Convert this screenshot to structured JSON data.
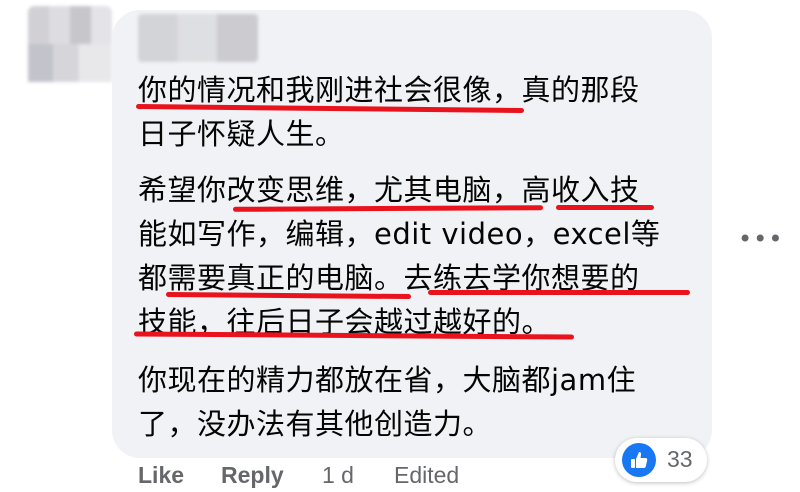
{
  "comment": {
    "paragraphs": [
      "你的情况和我刚进社会很像，真的那段\n日子怀疑人生。",
      "希望你改变思维，尤其电脑，高收入技\n能如写作，编辑，edit video，excel等\n都需要真正的电脑。去练去学你想要的\n技能，往后日子会越过越好的。",
      "你现在的精力都放在省，大脑都jam住\n了，没办法有其他创造力。"
    ],
    "highlight_color": "#e8131d"
  },
  "more_options": "•••",
  "actions": {
    "like": "Like",
    "reply": "Reply",
    "time": "1 d",
    "edited": "Edited"
  },
  "reactions": {
    "icon": "thumbs-up-icon",
    "count": "33",
    "color": "#1877f2"
  }
}
